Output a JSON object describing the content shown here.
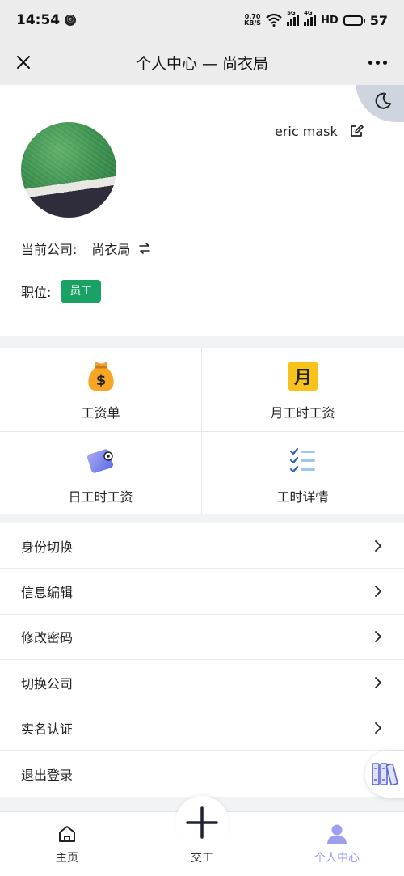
{
  "status_bar": {
    "time": "14:54",
    "notif_badge": "ⓔ",
    "net_speed_value": "0.70",
    "net_speed_unit": "KB/S",
    "sig1_tag": "5G",
    "sig2_tag": "4G",
    "hd": "HD",
    "battery_level": 57,
    "battery_text": "57",
    "battery_color": "#f5c518"
  },
  "nav": {
    "title": "个人中心 — 尚衣局",
    "close_icon": "close-icon",
    "more_icon": "more-icon"
  },
  "profile": {
    "user_name": "eric mask",
    "company_label": "当前公司:",
    "company_name": "尚衣局",
    "position_label": "职位:",
    "role": "员工",
    "role_color": "#1aa264"
  },
  "grid": [
    {
      "label": "工资单",
      "icon": "money-bag-icon"
    },
    {
      "label": "月工时工资",
      "icon": "month-calendar-icon",
      "icon_text": "月"
    },
    {
      "label": "日工时工资",
      "icon": "wallet-icon"
    },
    {
      "label": "工时详情",
      "icon": "checklist-icon"
    }
  ],
  "menu": [
    {
      "label": "身份切换"
    },
    {
      "label": "信息编辑"
    },
    {
      "label": "修改密码"
    },
    {
      "label": "切换公司"
    },
    {
      "label": "实名认证"
    },
    {
      "label": "退出登录"
    }
  ],
  "tabs": {
    "home": "主页",
    "center": "交工",
    "profile": "个人中心",
    "active_color": "#9d9ff0"
  }
}
